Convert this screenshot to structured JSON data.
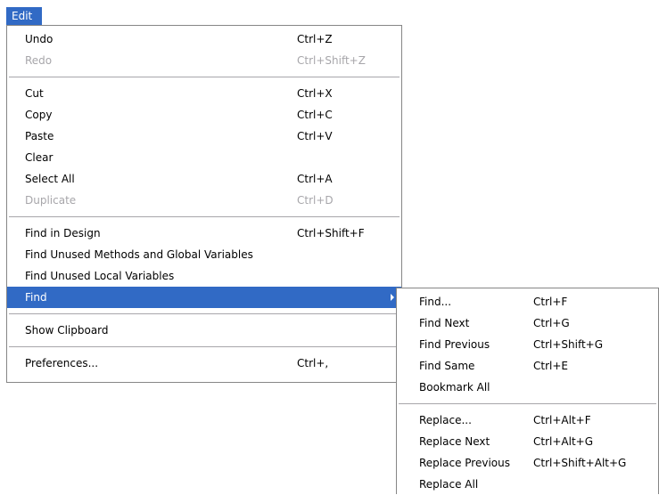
{
  "menubar": {
    "title": "Edit"
  },
  "edit_menu": {
    "undo": {
      "label": "Undo",
      "shortcut": "Ctrl+Z"
    },
    "redo": {
      "label": "Redo",
      "shortcut": "Ctrl+Shift+Z"
    },
    "cut": {
      "label": "Cut",
      "shortcut": "Ctrl+X"
    },
    "copy": {
      "label": "Copy",
      "shortcut": "Ctrl+C"
    },
    "paste": {
      "label": "Paste",
      "shortcut": "Ctrl+V"
    },
    "clear": {
      "label": "Clear"
    },
    "select_all": {
      "label": "Select All",
      "shortcut": "Ctrl+A"
    },
    "duplicate": {
      "label": "Duplicate",
      "shortcut": "Ctrl+D"
    },
    "find_in_design": {
      "label": "Find in Design",
      "shortcut": "Ctrl+Shift+F"
    },
    "find_unused_methods": {
      "label": "Find Unused Methods and Global Variables"
    },
    "find_unused_locals": {
      "label": "Find Unused Local Variables"
    },
    "find": {
      "label": "Find"
    },
    "show_clipboard": {
      "label": "Show Clipboard"
    },
    "preferences": {
      "label": "Preferences...",
      "shortcut": "Ctrl+,"
    }
  },
  "find_submenu": {
    "find": {
      "label": "Find...",
      "shortcut": "Ctrl+F"
    },
    "find_next": {
      "label": "Find Next",
      "shortcut": "Ctrl+G"
    },
    "find_previous": {
      "label": "Find Previous",
      "shortcut": "Ctrl+Shift+G"
    },
    "find_same": {
      "label": "Find Same",
      "shortcut": "Ctrl+E"
    },
    "bookmark_all": {
      "label": "Bookmark All"
    },
    "replace": {
      "label": "Replace...",
      "shortcut": "Ctrl+Alt+F"
    },
    "replace_next": {
      "label": "Replace Next",
      "shortcut": "Ctrl+Alt+G"
    },
    "replace_previous": {
      "label": "Replace Previous",
      "shortcut": "Ctrl+Shift+Alt+G"
    },
    "replace_all": {
      "label": "Replace All"
    }
  },
  "colors": {
    "highlight": "#316ac5",
    "disabled_text": "#a7a6aa",
    "border": "#868686"
  }
}
